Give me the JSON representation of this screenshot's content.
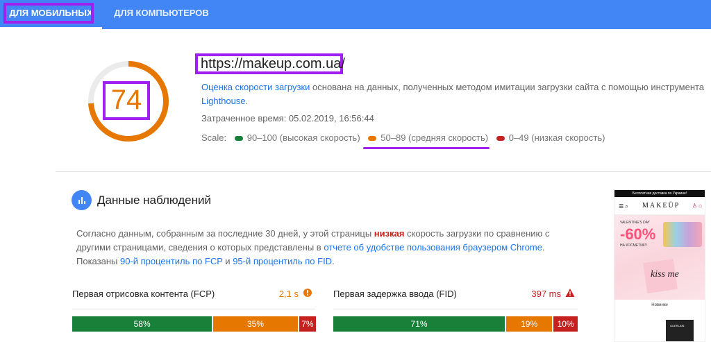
{
  "tabs": {
    "mobile": "ДЛЯ МОБИЛЬНЫХ",
    "desktop": "ДЛЯ КОМПЬЮТЕРОВ"
  },
  "summary": {
    "score": "74",
    "score_fraction": 0.74,
    "url": "https://makeup.com.ua/",
    "desc_link": "Оценка скорости загрузки",
    "desc_text": " основана на данных, полученных методом имитации загрузки сайта с помощью инструмента ",
    "desc_tool": "Lighthouse",
    "desc_end": ".",
    "elapsed": "Затраченное время: 05.02.2019, 16:56:44",
    "scale_label": "Scale:",
    "scale_fast": "90–100 (высокая скорость)",
    "scale_avg": "50–89 (средняя скорость)",
    "scale_slow": "0–49 (низкая скорость)"
  },
  "observed": {
    "title": "Данные наблюдений",
    "text1": "Согласно данным, собранным за последние 30 дней, у этой страницы ",
    "text_bad": "низкая",
    "text2": " скорость загрузки по сравнению с другими страницами, сведения о которых представлены в ",
    "text_link": "отчете об удобстве пользования браузером Chrome",
    "text3": ". Показаны ",
    "text_fcp_link": "90-й процентиль по FCP",
    "text4": " и ",
    "text_fid_link": "95-й процентиль по FID",
    "text5": "."
  },
  "metrics": {
    "fcp": {
      "label": "Первая отрисовка контента (FCP)",
      "value": "2,1 s",
      "bar": [
        "58%",
        "35%",
        "7%"
      ]
    },
    "fid": {
      "label": "Первая задержка ввода (FID)",
      "value": "397 ms",
      "bar": [
        "71%",
        "19%",
        "10%"
      ]
    }
  },
  "colors": {
    "good": "#188038",
    "average": "#e67700",
    "poor": "#c5221f",
    "highlight": "#a020f0"
  },
  "phone": {
    "topbar": "Бесплатная доставка по Украине!",
    "logo": "MAKEÜP",
    "banner_top": "VALENTINE'S DAY",
    "banner_sale": "-60%",
    "banner_sub": "НА КОСМЕТИКУ",
    "banner_card": "kiss me",
    "section": "Новинки",
    "product": "GUERLAIN"
  }
}
